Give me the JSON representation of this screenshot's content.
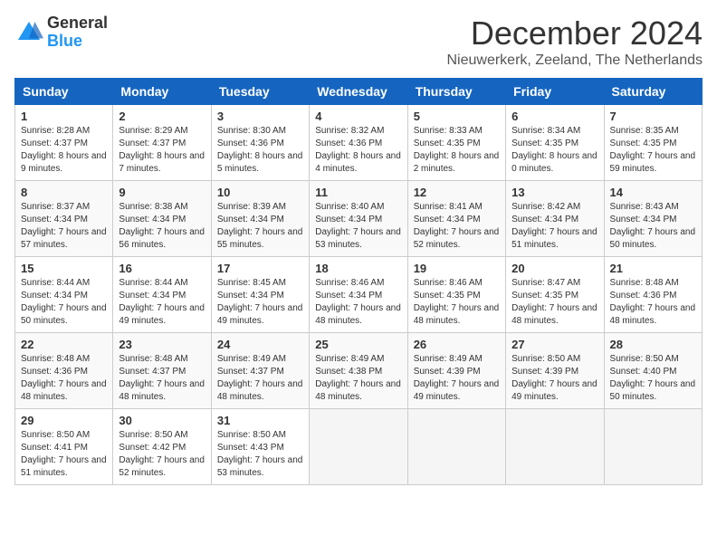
{
  "logo": {
    "general": "General",
    "blue": "Blue"
  },
  "title": "December 2024",
  "location": "Nieuwerkerk, Zeeland, The Netherlands",
  "days_of_week": [
    "Sunday",
    "Monday",
    "Tuesday",
    "Wednesday",
    "Thursday",
    "Friday",
    "Saturday"
  ],
  "weeks": [
    [
      {
        "day": "1",
        "sunrise": "8:28 AM",
        "sunset": "4:37 PM",
        "daylight": "8 hours and 9 minutes."
      },
      {
        "day": "2",
        "sunrise": "8:29 AM",
        "sunset": "4:37 PM",
        "daylight": "8 hours and 7 minutes."
      },
      {
        "day": "3",
        "sunrise": "8:30 AM",
        "sunset": "4:36 PM",
        "daylight": "8 hours and 5 minutes."
      },
      {
        "day": "4",
        "sunrise": "8:32 AM",
        "sunset": "4:36 PM",
        "daylight": "8 hours and 4 minutes."
      },
      {
        "day": "5",
        "sunrise": "8:33 AM",
        "sunset": "4:35 PM",
        "daylight": "8 hours and 2 minutes."
      },
      {
        "day": "6",
        "sunrise": "8:34 AM",
        "sunset": "4:35 PM",
        "daylight": "8 hours and 0 minutes."
      },
      {
        "day": "7",
        "sunrise": "8:35 AM",
        "sunset": "4:35 PM",
        "daylight": "7 hours and 59 minutes."
      }
    ],
    [
      {
        "day": "8",
        "sunrise": "8:37 AM",
        "sunset": "4:34 PM",
        "daylight": "7 hours and 57 minutes."
      },
      {
        "day": "9",
        "sunrise": "8:38 AM",
        "sunset": "4:34 PM",
        "daylight": "7 hours and 56 minutes."
      },
      {
        "day": "10",
        "sunrise": "8:39 AM",
        "sunset": "4:34 PM",
        "daylight": "7 hours and 55 minutes."
      },
      {
        "day": "11",
        "sunrise": "8:40 AM",
        "sunset": "4:34 PM",
        "daylight": "7 hours and 53 minutes."
      },
      {
        "day": "12",
        "sunrise": "8:41 AM",
        "sunset": "4:34 PM",
        "daylight": "7 hours and 52 minutes."
      },
      {
        "day": "13",
        "sunrise": "8:42 AM",
        "sunset": "4:34 PM",
        "daylight": "7 hours and 51 minutes."
      },
      {
        "day": "14",
        "sunrise": "8:43 AM",
        "sunset": "4:34 PM",
        "daylight": "7 hours and 50 minutes."
      }
    ],
    [
      {
        "day": "15",
        "sunrise": "8:44 AM",
        "sunset": "4:34 PM",
        "daylight": "7 hours and 50 minutes."
      },
      {
        "day": "16",
        "sunrise": "8:44 AM",
        "sunset": "4:34 PM",
        "daylight": "7 hours and 49 minutes."
      },
      {
        "day": "17",
        "sunrise": "8:45 AM",
        "sunset": "4:34 PM",
        "daylight": "7 hours and 49 minutes."
      },
      {
        "day": "18",
        "sunrise": "8:46 AM",
        "sunset": "4:34 PM",
        "daylight": "7 hours and 48 minutes."
      },
      {
        "day": "19",
        "sunrise": "8:46 AM",
        "sunset": "4:35 PM",
        "daylight": "7 hours and 48 minutes."
      },
      {
        "day": "20",
        "sunrise": "8:47 AM",
        "sunset": "4:35 PM",
        "daylight": "7 hours and 48 minutes."
      },
      {
        "day": "21",
        "sunrise": "8:48 AM",
        "sunset": "4:36 PM",
        "daylight": "7 hours and 48 minutes."
      }
    ],
    [
      {
        "day": "22",
        "sunrise": "8:48 AM",
        "sunset": "4:36 PM",
        "daylight": "7 hours and 48 minutes."
      },
      {
        "day": "23",
        "sunrise": "8:48 AM",
        "sunset": "4:37 PM",
        "daylight": "7 hours and 48 minutes."
      },
      {
        "day": "24",
        "sunrise": "8:49 AM",
        "sunset": "4:37 PM",
        "daylight": "7 hours and 48 minutes."
      },
      {
        "day": "25",
        "sunrise": "8:49 AM",
        "sunset": "4:38 PM",
        "daylight": "7 hours and 48 minutes."
      },
      {
        "day": "26",
        "sunrise": "8:49 AM",
        "sunset": "4:39 PM",
        "daylight": "7 hours and 49 minutes."
      },
      {
        "day": "27",
        "sunrise": "8:50 AM",
        "sunset": "4:39 PM",
        "daylight": "7 hours and 49 minutes."
      },
      {
        "day": "28",
        "sunrise": "8:50 AM",
        "sunset": "4:40 PM",
        "daylight": "7 hours and 50 minutes."
      }
    ],
    [
      {
        "day": "29",
        "sunrise": "8:50 AM",
        "sunset": "4:41 PM",
        "daylight": "7 hours and 51 minutes."
      },
      {
        "day": "30",
        "sunrise": "8:50 AM",
        "sunset": "4:42 PM",
        "daylight": "7 hours and 52 minutes."
      },
      {
        "day": "31",
        "sunrise": "8:50 AM",
        "sunset": "4:43 PM",
        "daylight": "7 hours and 53 minutes."
      },
      null,
      null,
      null,
      null
    ]
  ]
}
